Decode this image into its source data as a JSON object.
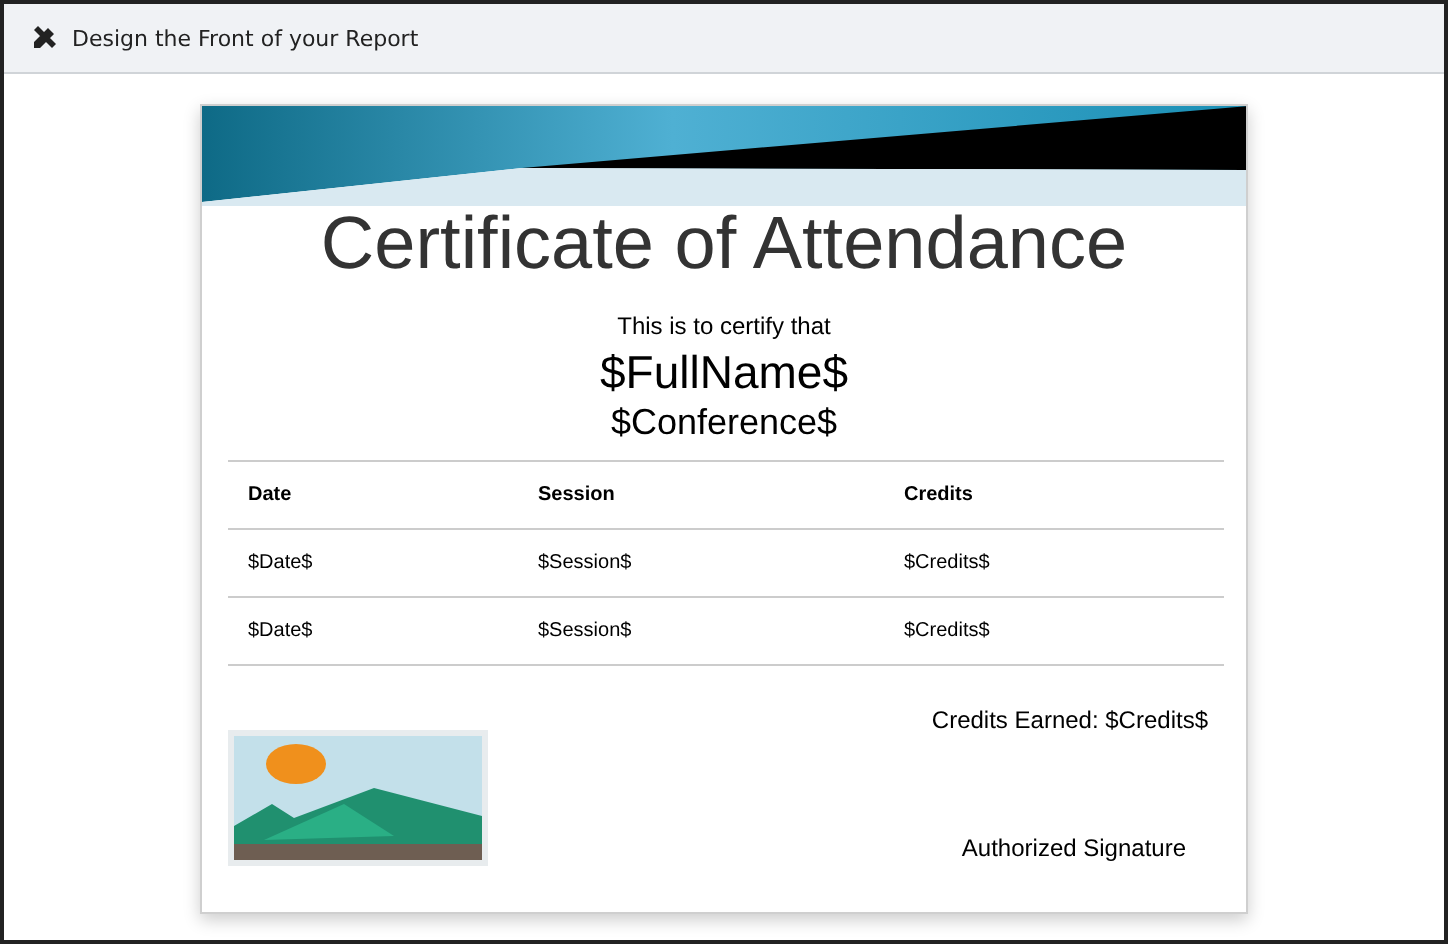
{
  "header": {
    "title": "Design the Front of your Report"
  },
  "certificate": {
    "title": "Certificate of Attendance",
    "intro": "This is to certify that",
    "name": "$FullName$",
    "conference": "$Conference$",
    "table": {
      "columns": [
        "Date",
        "Session",
        "Credits"
      ],
      "rows": [
        [
          "$Date$",
          "$Session$",
          "$Credits$"
        ],
        [
          "$Date$",
          "$Session$",
          "$Credits$"
        ]
      ]
    },
    "credits_earned": "Credits Earned: $Credits$",
    "signature": "Authorized Signature"
  }
}
